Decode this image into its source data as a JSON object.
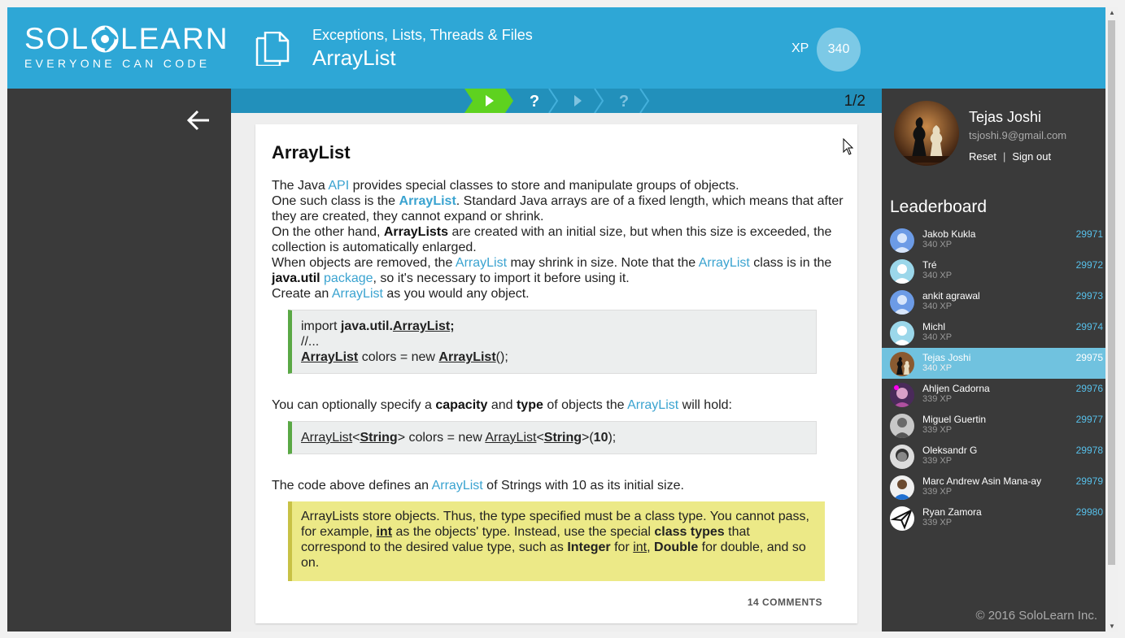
{
  "header": {
    "logo_left": "SOL",
    "logo_right": "LEARN",
    "tagline": "EVERYONE CAN CODE",
    "course": "Exceptions, Lists, Threads & Files",
    "lesson": "ArrayList",
    "xp_label": "XP",
    "xp_value": "340"
  },
  "progress": {
    "steps": [
      "play-icon",
      "question-icon",
      "play-icon",
      "question-icon"
    ],
    "counter": "1/2"
  },
  "lesson_card": {
    "title": "ArrayList",
    "p1": {
      "a": "The Java ",
      "api": "API",
      "b": " provides special classes to store and manipulate groups of objects.",
      "c": "One such class is the ",
      "al": "ArrayList",
      "d": ". Standard Java arrays are of a fixed length, which means that after they are created, they cannot expand or shrink.",
      "e": "On the other hand, ",
      "als": "ArrayLists",
      "f": " are created with an initial size, but when this size is exceeded, the collection is automatically enlarged.",
      "g": "When objects are removed, the ",
      "al2": "ArrayList",
      "h": " may shrink in size. Note that the ",
      "al3": "ArrayList",
      "i": " class is in the ",
      "jutil": "java.util",
      "pkg": "package",
      "j": ", so it's necessary to import it before using it.",
      "k": "Create an ",
      "al4": "ArrayList",
      "l": " as you would any object."
    },
    "code1": {
      "import": "import ",
      "pkg": "java.util.",
      "cls": "ArrayList",
      "semi": ";",
      "comment": "//...",
      "decl_type": "ArrayList",
      "decl_mid": " colors = new ",
      "decl_cls": "ArrayList",
      "decl_end": "();"
    },
    "p2": {
      "a": "You can optionally specify a ",
      "cap": "capacity",
      "b": " and ",
      "type": "type",
      "c": " of objects the ",
      "al": "ArrayList",
      "d": " will hold:"
    },
    "code2": {
      "t1": "ArrayList",
      "lt1": "<",
      "s1": "String",
      "gt1": ">",
      "mid": " colors = new ",
      "t2": "ArrayList",
      "lt2": "<",
      "s2": "String",
      "gt2": ">(",
      "num": "10",
      "end": ");"
    },
    "p3": {
      "a": "The code above defines an ",
      "al": "ArrayList",
      "b": " of Strings with 10 as its initial size."
    },
    "note": {
      "a": "ArrayLists store objects. Thus, the type specified must be a class type. You cannot pass, for example, ",
      "int1": "int",
      "b": " as the objects' type. Instead, use the special ",
      "ct": "class types",
      "c": " that correspond to the desired value type, such as ",
      "integer": "Integer",
      "d": " for ",
      "int2": "int",
      "e": ", ",
      "double": "Double",
      "f": " for double, and so on."
    },
    "comments": "14 COMMENTS"
  },
  "user": {
    "name": "Tejas Joshi",
    "email": "tsjoshi.9@gmail.com",
    "reset": "Reset",
    "separator": "|",
    "signout": "Sign out"
  },
  "leaderboard": {
    "title": "Leaderboard",
    "rows": [
      {
        "name": "Jakob Kukla",
        "xp": "340 XP",
        "rank": "29971",
        "avatar": "default",
        "active": false
      },
      {
        "name": "Tré",
        "xp": "340 XP",
        "rank": "29972",
        "avatar": "default-light",
        "active": false
      },
      {
        "name": "ankit agrawal",
        "xp": "340 XP",
        "rank": "29973",
        "avatar": "default",
        "active": false
      },
      {
        "name": "Michl",
        "xp": "340 XP",
        "rank": "29974",
        "avatar": "default-light",
        "active": false
      },
      {
        "name": "Tejas Joshi",
        "xp": "340 XP",
        "rank": "29975",
        "avatar": "chess",
        "active": true
      },
      {
        "name": "Ahljen Cadorna",
        "xp": "339 XP",
        "rank": "29976",
        "avatar": "photo-purple",
        "active": false
      },
      {
        "name": "Miguel Guertin",
        "xp": "339 XP",
        "rank": "29977",
        "avatar": "photo-grey",
        "active": false
      },
      {
        "name": "Oleksandr G",
        "xp": "339 XP",
        "rank": "29978",
        "avatar": "photo-dark",
        "active": false
      },
      {
        "name": "Marc Andrew Asin Mana-ay",
        "xp": "339 XP",
        "rank": "29979",
        "avatar": "photo-blue",
        "active": false
      },
      {
        "name": "Ryan Zamora",
        "xp": "339 XP",
        "rank": "29980",
        "avatar": "paper-plane",
        "active": false
      }
    ]
  },
  "footer": {
    "copyright": "© 2016 SoloLearn Inc."
  },
  "colors": {
    "header": "#2ea7d6",
    "link": "#3aa3d0",
    "step_active": "#5ed21f",
    "panel": "#3a3a3a"
  }
}
